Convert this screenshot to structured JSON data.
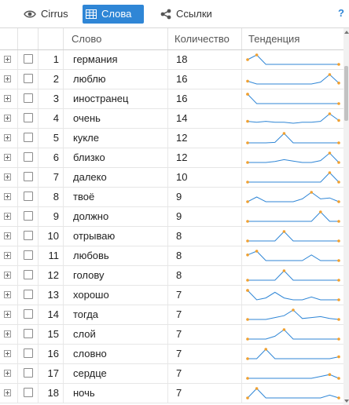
{
  "toolbar": {
    "tabs": [
      {
        "label": "Cirrus",
        "icon": "eye-icon",
        "active": false
      },
      {
        "label": "Слова",
        "icon": "table-icon",
        "active": true
      },
      {
        "label": "Ссылки",
        "icon": "share-icon",
        "active": false
      }
    ],
    "help_label": "?"
  },
  "table": {
    "headers": {
      "word": "Слово",
      "count": "Количество",
      "trend": "Тенденция"
    },
    "rows": [
      {
        "num": "1",
        "word": "германия",
        "count": "18",
        "trend": [
          0.5,
          1,
          0,
          0,
          0,
          0,
          0,
          0,
          0,
          0,
          0
        ]
      },
      {
        "num": "2",
        "word": "люблю",
        "count": "16",
        "trend": [
          0.3,
          0,
          0,
          0,
          0,
          0,
          0,
          0,
          0.2,
          1,
          0.1
        ]
      },
      {
        "num": "3",
        "word": "иностранец",
        "count": "16",
        "trend": [
          1,
          0,
          0,
          0,
          0,
          0,
          0,
          0,
          0,
          0,
          0
        ]
      },
      {
        "num": "4",
        "word": "очень",
        "count": "14",
        "trend": [
          0.2,
          0.1,
          0.2,
          0.1,
          0.1,
          0,
          0.1,
          0.1,
          0.2,
          1,
          0.3
        ]
      },
      {
        "num": "5",
        "word": "кукле",
        "count": "12",
        "trend": [
          0,
          0,
          0,
          0.05,
          1,
          0,
          0,
          0,
          0,
          0,
          0
        ]
      },
      {
        "num": "6",
        "word": "близко",
        "count": "12",
        "trend": [
          0,
          0,
          0,
          0.1,
          0.3,
          0.15,
          0,
          0,
          0.2,
          1,
          0
        ]
      },
      {
        "num": "7",
        "word": "далеко",
        "count": "10",
        "trend": [
          0,
          0,
          0,
          0,
          0,
          0,
          0,
          0,
          0,
          1,
          0
        ]
      },
      {
        "num": "8",
        "word": "твоё",
        "count": "9",
        "trend": [
          0,
          0.5,
          0,
          0,
          0,
          0,
          0.3,
          1,
          0.3,
          0.4,
          0
        ]
      },
      {
        "num": "9",
        "word": "должно",
        "count": "9",
        "trend": [
          0,
          0,
          0,
          0,
          0,
          0,
          0,
          0,
          1,
          0,
          0
        ]
      },
      {
        "num": "10",
        "word": "отрываю",
        "count": "8",
        "trend": [
          0,
          0,
          0,
          0,
          1,
          0,
          0,
          0,
          0,
          0,
          0
        ]
      },
      {
        "num": "11",
        "word": "любовь",
        "count": "8",
        "trend": [
          0.6,
          1,
          0,
          0,
          0,
          0,
          0,
          0.6,
          0,
          0,
          0
        ]
      },
      {
        "num": "12",
        "word": "голову",
        "count": "8",
        "trend": [
          0,
          0,
          0,
          0,
          1,
          0,
          0,
          0,
          0,
          0,
          0
        ]
      },
      {
        "num": "13",
        "word": "хорошо",
        "count": "7",
        "trend": [
          1,
          0,
          0.2,
          0.8,
          0.2,
          0,
          0,
          0.3,
          0,
          0,
          0
        ]
      },
      {
        "num": "14",
        "word": "тогда",
        "count": "7",
        "trend": [
          0,
          0,
          0,
          0.2,
          0.4,
          1,
          0.1,
          0.2,
          0.3,
          0.1,
          0
        ]
      },
      {
        "num": "15",
        "word": "слой",
        "count": "7",
        "trend": [
          0,
          0,
          0,
          0.3,
          1,
          0,
          0,
          0,
          0,
          0,
          0
        ]
      },
      {
        "num": "16",
        "word": "словно",
        "count": "7",
        "trend": [
          0,
          0,
          1,
          0,
          0,
          0,
          0,
          0,
          0,
          0,
          0.2
        ]
      },
      {
        "num": "17",
        "word": "сердце",
        "count": "7",
        "trend": [
          0,
          0,
          0,
          0,
          0,
          0,
          0,
          0,
          0.2,
          0.4,
          0
        ]
      },
      {
        "num": "18",
        "word": "ночь",
        "count": "7",
        "trend": [
          0,
          1,
          0,
          0,
          0,
          0,
          0,
          0,
          0,
          0.3,
          0
        ]
      }
    ]
  },
  "colors": {
    "accent": "#2f86d6",
    "sparkline": "#2f86d6",
    "endpoint": "#f0a030"
  }
}
